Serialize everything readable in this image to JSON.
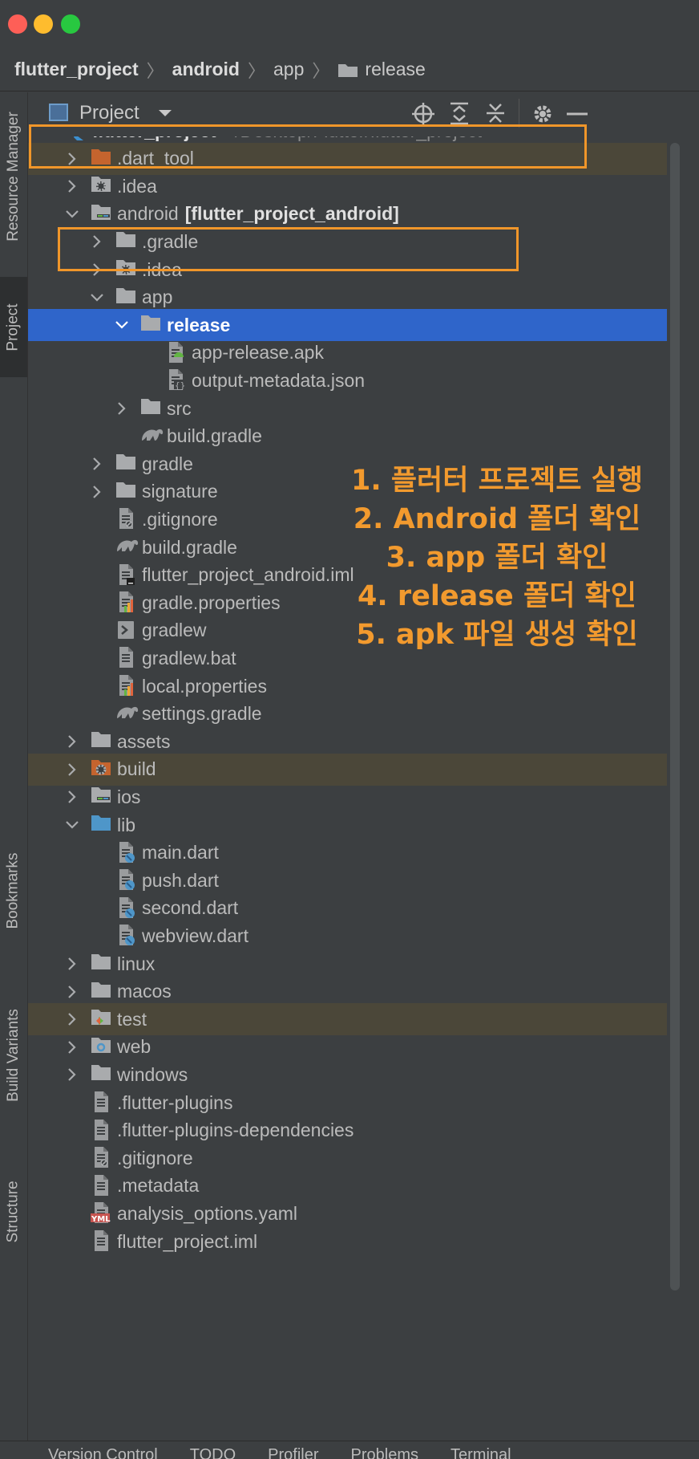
{
  "breadcrumb": [
    {
      "label": "flutter_project",
      "bold": true
    },
    {
      "label": "android",
      "bold": true
    },
    {
      "label": "app",
      "bold": false
    },
    {
      "label": "release",
      "bold": false,
      "folder": true
    }
  ],
  "side_tabs": {
    "resource_manager": "Resource Manager",
    "project": "Project",
    "bookmarks": "Bookmarks",
    "build_variants": "Build Variants",
    "structure": "Structure"
  },
  "panel": {
    "title": "Project"
  },
  "tree": [
    {
      "name": "flutter_project",
      "hint": "~/Desktop/Flutter/flutter_project",
      "depth": 0,
      "chev": "down",
      "icon": "flutter",
      "bold": true
    },
    {
      "name": ".dart_tool",
      "depth": 1,
      "chev": "right",
      "icon": "folder-orange",
      "excluded": true
    },
    {
      "name": ".idea",
      "depth": 1,
      "chev": "right",
      "icon": "folder-gear"
    },
    {
      "name": "android",
      "module": "[flutter_project_android]",
      "depth": 1,
      "chev": "down",
      "icon": "folder-module"
    },
    {
      "name": ".gradle",
      "depth": 2,
      "chev": "right",
      "icon": "folder"
    },
    {
      "name": ".idea",
      "depth": 2,
      "chev": "right",
      "icon": "folder-gear"
    },
    {
      "name": "app",
      "depth": 2,
      "chev": "down",
      "icon": "folder"
    },
    {
      "name": "release",
      "depth": 3,
      "chev": "down",
      "icon": "folder",
      "selected": true
    },
    {
      "name": "app-release.apk",
      "depth": 4,
      "icon": "apk"
    },
    {
      "name": "output-metadata.json",
      "depth": 4,
      "icon": "json"
    },
    {
      "name": "src",
      "depth": 3,
      "chev": "right",
      "icon": "folder"
    },
    {
      "name": "build.gradle",
      "depth": 3,
      "icon": "gradle"
    },
    {
      "name": "gradle",
      "depth": 2,
      "chev": "right",
      "icon": "folder"
    },
    {
      "name": "signature",
      "depth": 2,
      "chev": "right",
      "icon": "folder"
    },
    {
      "name": ".gitignore",
      "depth": 2,
      "icon": "gitignore"
    },
    {
      "name": "build.gradle",
      "depth": 2,
      "icon": "gradle"
    },
    {
      "name": "flutter_project_android.iml",
      "depth": 2,
      "icon": "iml"
    },
    {
      "name": "gradle.properties",
      "depth": 2,
      "icon": "properties"
    },
    {
      "name": "gradlew",
      "depth": 2,
      "icon": "shell"
    },
    {
      "name": "gradlew.bat",
      "depth": 2,
      "icon": "file"
    },
    {
      "name": "local.properties",
      "depth": 2,
      "icon": "properties"
    },
    {
      "name": "settings.gradle",
      "depth": 2,
      "icon": "gradle"
    },
    {
      "name": "assets",
      "depth": 1,
      "chev": "right",
      "icon": "folder"
    },
    {
      "name": "build",
      "depth": 1,
      "chev": "right",
      "icon": "folder-orange-gear",
      "excluded": true
    },
    {
      "name": "ios",
      "depth": 1,
      "chev": "right",
      "icon": "folder-module"
    },
    {
      "name": "lib",
      "depth": 1,
      "chev": "down",
      "icon": "folder-blue"
    },
    {
      "name": "main.dart",
      "depth": 2,
      "icon": "dart"
    },
    {
      "name": "push.dart",
      "depth": 2,
      "icon": "dart"
    },
    {
      "name": "second.dart",
      "depth": 2,
      "icon": "dart"
    },
    {
      "name": "webview.dart",
      "depth": 2,
      "icon": "dart"
    },
    {
      "name": "linux",
      "depth": 1,
      "chev": "right",
      "icon": "folder"
    },
    {
      "name": "macos",
      "depth": 1,
      "chev": "right",
      "icon": "folder"
    },
    {
      "name": "test",
      "depth": 1,
      "chev": "right",
      "icon": "folder-test",
      "excluded": true
    },
    {
      "name": "web",
      "depth": 1,
      "chev": "right",
      "icon": "folder-web"
    },
    {
      "name": "windows",
      "depth": 1,
      "chev": "right",
      "icon": "folder"
    },
    {
      "name": ".flutter-plugins",
      "depth": 1,
      "icon": "file"
    },
    {
      "name": ".flutter-plugins-dependencies",
      "depth": 1,
      "icon": "file"
    },
    {
      "name": ".gitignore",
      "depth": 1,
      "icon": "gitignore"
    },
    {
      "name": ".metadata",
      "depth": 1,
      "icon": "file"
    },
    {
      "name": "analysis_options.yaml",
      "depth": 1,
      "icon": "yaml"
    },
    {
      "name": "flutter_project.iml",
      "depth": 1,
      "icon": "file"
    }
  ],
  "annotation_steps": [
    "1. 플러터 프로젝트 실행",
    "2. Android 폴더 확인",
    "3. app 폴더 확인",
    "4. release 폴더 확인",
    "5. apk 파일 생성 확인"
  ],
  "bottom_tabs": [
    "Version Control",
    "TODO",
    "Profiler",
    "Problems",
    "Terminal"
  ],
  "colors": {
    "accent": "#f29a2e",
    "selection": "#2f65ca",
    "excluded_bg": "#4b4739",
    "folder": "#a9abad"
  }
}
